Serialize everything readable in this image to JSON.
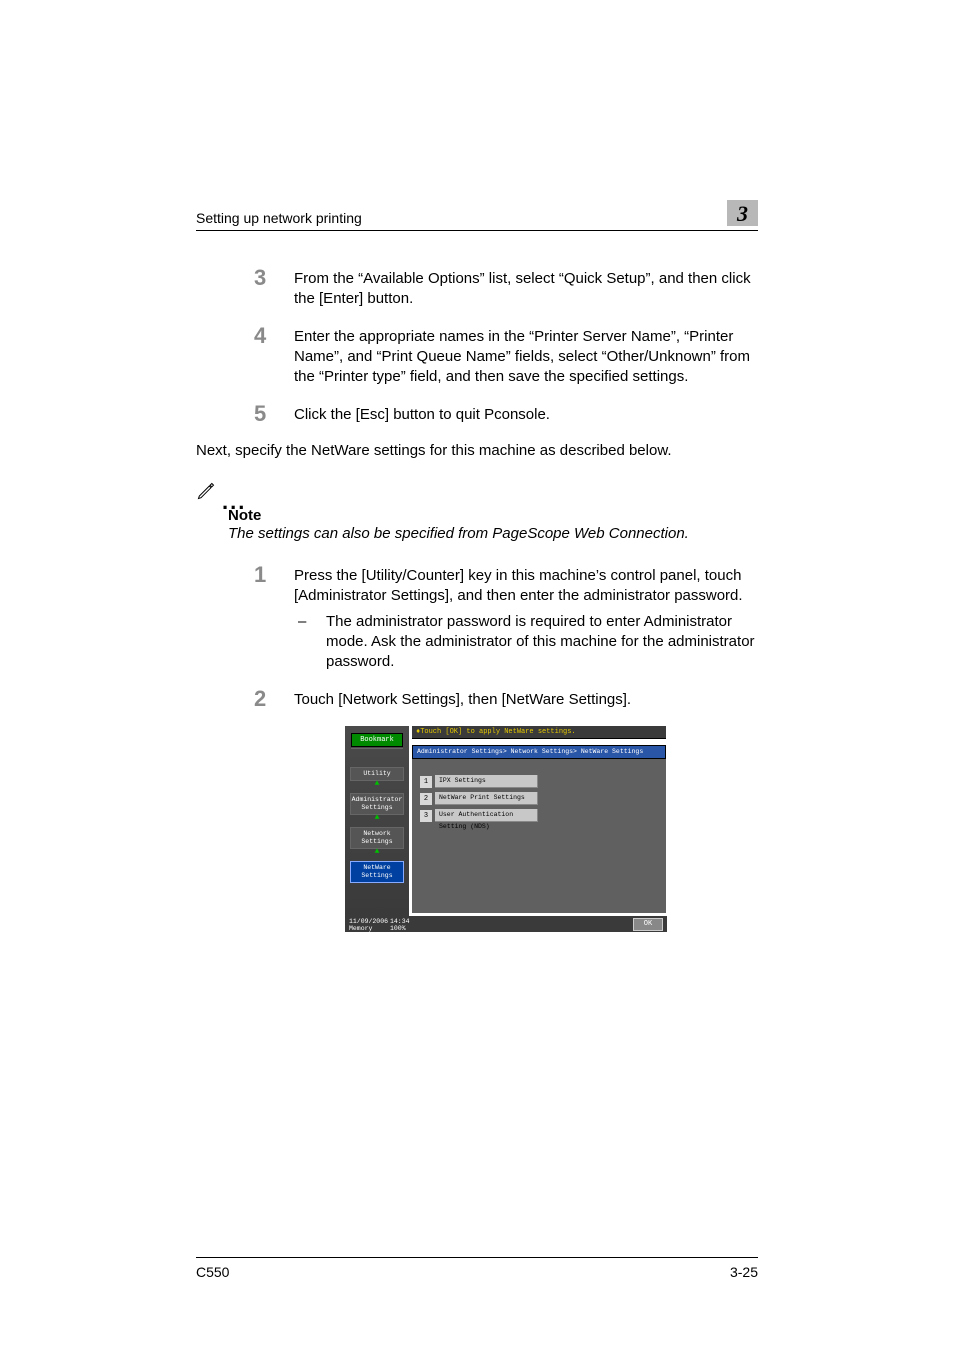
{
  "header": {
    "section_title": "Setting up network printing",
    "chapter_number": "3"
  },
  "steps_a": [
    {
      "num": "3",
      "text": "From the “Available Options” list, select “Quick Setup”, and then click the [Enter] button."
    },
    {
      "num": "4",
      "text": "Enter the appropriate names in the “Printer Server Name”, “Printer Name”, and “Print Queue Name” fields, select “Other/Unknown” from the “Printer type” field, and then save the specified settings."
    },
    {
      "num": "5",
      "text": "Click the [Esc] button to quit Pconsole."
    }
  ],
  "next_line": "Next, specify the NetWare settings for this machine as described below.",
  "note": {
    "label": "Note",
    "text": "The settings can also be specified from PageScope Web Connection."
  },
  "steps_b": [
    {
      "num": "1",
      "text": "Press the [Utility/Counter] key in this machine’s control panel, touch [Administrator Settings], and then enter the administrator password.",
      "sub": "The administrator password is required to enter Administrator mode. Ask the administrator of this machine for the administrator password."
    },
    {
      "num": "2",
      "text": "Touch [Network Settings], then [NetWare Settings]."
    }
  ],
  "screenshot": {
    "bookmark": "Bookmark",
    "top_hint": "Touch [OK] to apply NetWare settings.",
    "breadcrumb_bar": "Administrator Settings> Network Settings> NetWare Settings",
    "left_crumbs": [
      "Utility",
      "Administrator Settings",
      "Network Settings",
      "NetWare Settings"
    ],
    "menu": [
      {
        "n": "1",
        "label": "IPX Settings"
      },
      {
        "n": "2",
        "label": "NetWare Print Settings"
      },
      {
        "n": "3",
        "label": "User Authentication Setting (NDS)"
      }
    ],
    "date": "11/09/2006",
    "time": "14:34",
    "memory_label": "Memory",
    "memory_value": "100%",
    "ok": "OK"
  },
  "footer": {
    "model": "C550",
    "page": "3-25"
  }
}
